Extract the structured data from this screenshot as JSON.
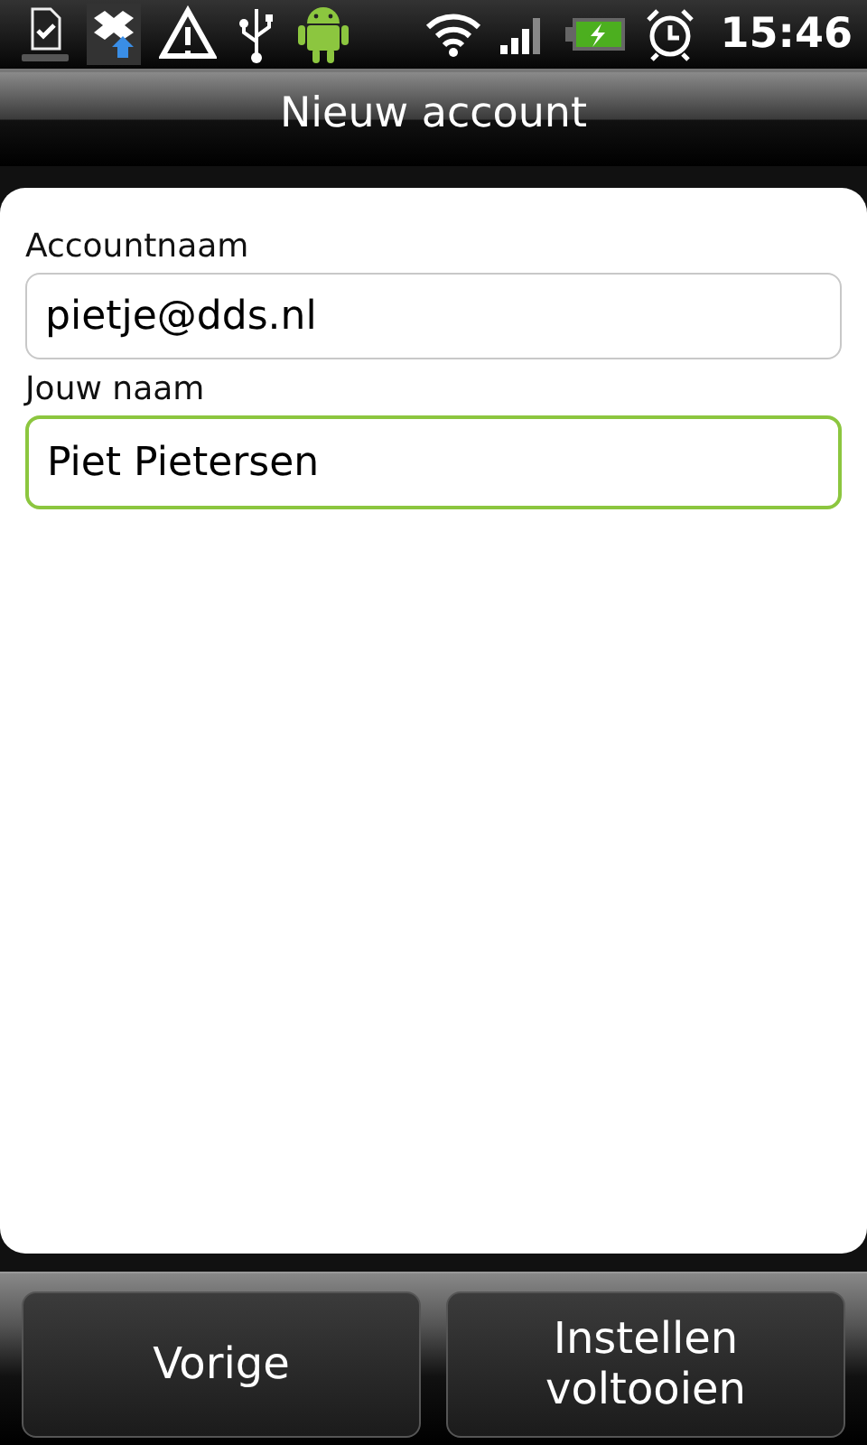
{
  "status_bar": {
    "time": "15:46"
  },
  "title_bar": {
    "title": "Nieuw account"
  },
  "fields": [
    {
      "label": "Accountnaam",
      "value": "pietje@dds.nl",
      "focused": false
    },
    {
      "label": "Jouw naam",
      "value": "Piet Pietersen",
      "focused": true
    }
  ],
  "buttons": [
    "Vorige",
    "Instellen voltooien"
  ]
}
